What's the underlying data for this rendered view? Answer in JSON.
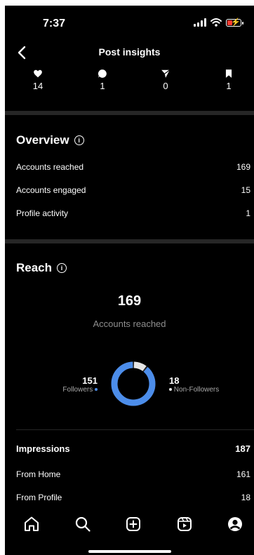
{
  "status_bar": {
    "time": "7:37"
  },
  "header": {
    "title": "Post insights"
  },
  "stats": [
    {
      "icon": "heart-icon",
      "value": "14"
    },
    {
      "icon": "comment-icon",
      "value": "1"
    },
    {
      "icon": "share-icon",
      "value": "0"
    },
    {
      "icon": "bookmark-icon",
      "value": "1"
    }
  ],
  "overview": {
    "title": "Overview",
    "rows": [
      {
        "label": "Accounts reached",
        "value": "169"
      },
      {
        "label": "Accounts engaged",
        "value": "15"
      },
      {
        "label": "Profile activity",
        "value": "1"
      }
    ]
  },
  "reach": {
    "title": "Reach",
    "total": "169",
    "total_label": "Accounts reached",
    "followers": {
      "value": "151",
      "label": "Followers",
      "color": "#4c8dea"
    },
    "non_followers": {
      "value": "18",
      "label": "Non-Followers",
      "color": "#e6e6e6"
    }
  },
  "impressions": {
    "title": "Impressions",
    "total": "187",
    "rows": [
      {
        "label": "From Home",
        "value": "161"
      },
      {
        "label": "From Profile",
        "value": "18"
      }
    ]
  },
  "tab_bar": [
    "home-icon",
    "search-icon",
    "create-icon",
    "reels-icon",
    "profile-icon"
  ],
  "colors": {
    "background": "#000000",
    "accent": "#4c8dea",
    "muted_text": "#8e8e8e",
    "divider": "#262626"
  }
}
